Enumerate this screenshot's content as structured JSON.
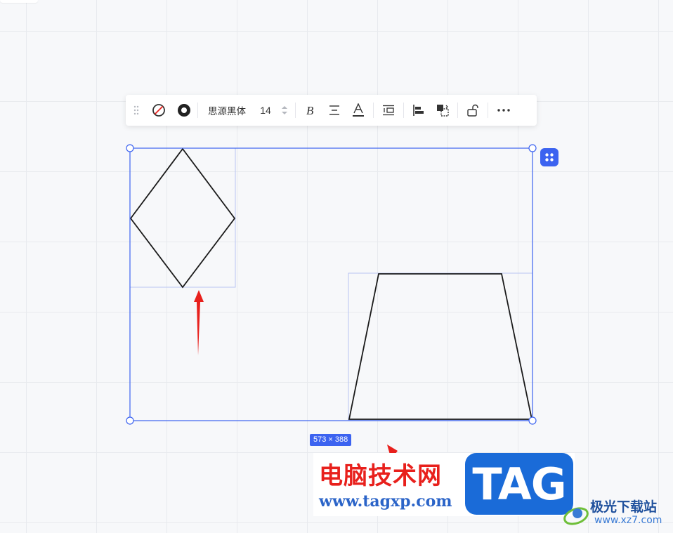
{
  "toolbar": {
    "font_family": "思源黑体",
    "font_size": "14",
    "icons": [
      "drag-handle-icon",
      "no-fill-icon",
      "stroke-color-icon",
      "font-size-stepper-icon",
      "bold-icon",
      "text-align-icon",
      "font-color-icon",
      "line-spacing-icon",
      "align-left-icon",
      "arrange-icon",
      "unlock-icon",
      "more-icon"
    ]
  },
  "selection": {
    "size_label": "573 × 388",
    "selection_color": "#3c63f0"
  },
  "shapes": [
    "diamond",
    "trapezoid"
  ],
  "watermark": {
    "site_cn": "电脑技术网",
    "site_url": "www.tagxp.com",
    "tag_label": "TAG",
    "xz_cn": "极光下载站",
    "xz_url": "www.xz7.com"
  },
  "colors": {
    "canvas_bg": "#f7f8fa",
    "accent": "#3c63f0",
    "arrow": "#e8201c"
  }
}
